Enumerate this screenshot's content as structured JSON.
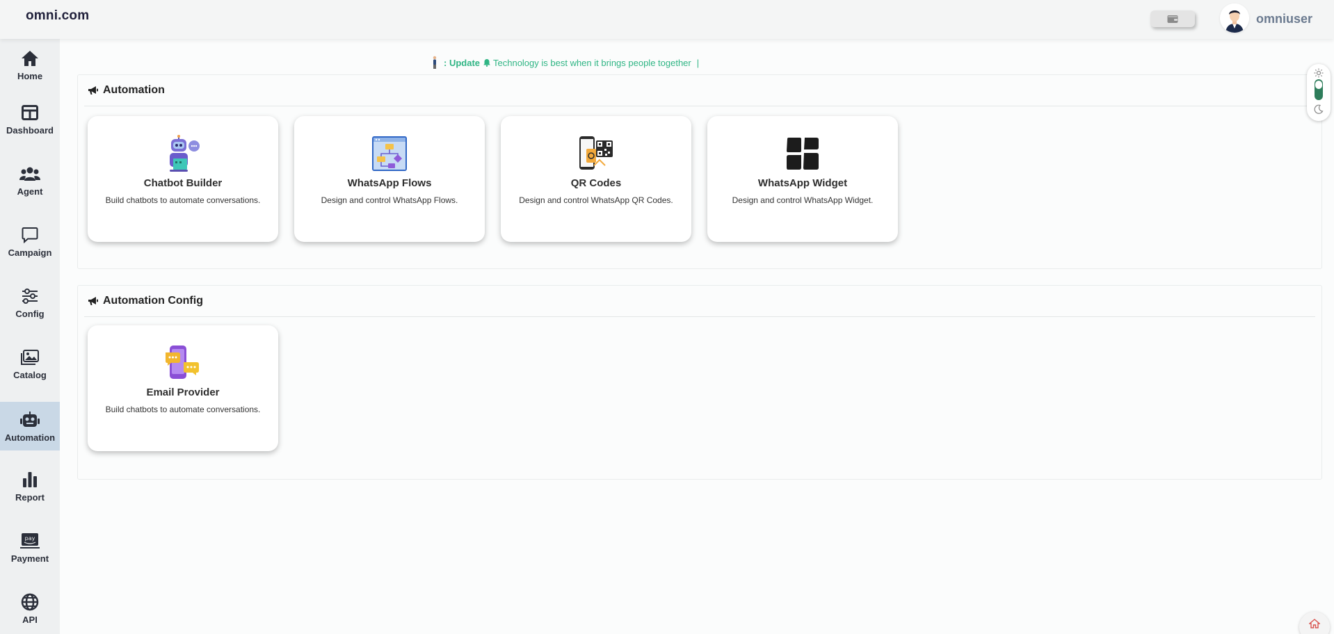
{
  "header": {
    "brand": "omni.com",
    "username": "omniuser",
    "wallet_icon": "wallet-icon",
    "avatar_icon": "user-avatar-icon"
  },
  "sidebar": {
    "items": [
      {
        "label": "Home",
        "icon": "home-icon"
      },
      {
        "label": "Dashboard",
        "icon": "dashboard-icon"
      },
      {
        "label": "Agent",
        "icon": "agent-icon"
      },
      {
        "label": "Campaign",
        "icon": "campaign-icon"
      },
      {
        "label": "Config",
        "icon": "config-icon"
      },
      {
        "label": "Catalog",
        "icon": "catalog-icon"
      },
      {
        "label": "Automation",
        "icon": "automation-icon",
        "active": true
      },
      {
        "label": "Report",
        "icon": "report-icon"
      },
      {
        "label": "Payment",
        "icon": "payment-icon"
      },
      {
        "label": "API",
        "icon": "api-icon"
      }
    ]
  },
  "update": {
    "prefix": ": Update",
    "message": "Technology is best when it brings people together",
    "cursor": "|"
  },
  "automation": {
    "title": "Automation",
    "cards": [
      {
        "title": "Chatbot Builder",
        "desc": "Build chatbots to automate conversations.",
        "icon": "chatbot-robot-icon"
      },
      {
        "title": "WhatsApp Flows",
        "desc": "Design and control WhatsApp Flows.",
        "icon": "flows-icon"
      },
      {
        "title": "QR Codes",
        "desc": "Design and control WhatsApp QR Codes.",
        "icon": "qr-code-icon"
      },
      {
        "title": "WhatsApp Widget",
        "desc": "Design and control WhatsApp Widget.",
        "icon": "widget-icon"
      }
    ]
  },
  "automation_config": {
    "title": "Automation Config",
    "cards": [
      {
        "title": "Email Provider",
        "desc": "Build chatbots to automate conversations.",
        "icon": "email-provider-icon"
      }
    ]
  },
  "colors": {
    "accent_green": "#2fb584",
    "toggle_green": "#2e7d5b",
    "sidebar_active": "#c9d8e6"
  }
}
